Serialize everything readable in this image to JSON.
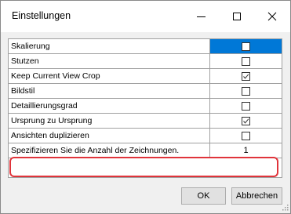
{
  "window": {
    "title": "Einstellungen"
  },
  "rows": [
    {
      "label": "Skalierung",
      "type": "checkbox",
      "checked": false,
      "selected": true
    },
    {
      "label": "Stutzen",
      "type": "checkbox",
      "checked": false,
      "selected": false
    },
    {
      "label": "Keep Current View Crop",
      "type": "checkbox",
      "checked": true,
      "selected": false
    },
    {
      "label": "Bildstil",
      "type": "checkbox",
      "checked": false,
      "selected": false
    },
    {
      "label": "Detaillierungsgrad",
      "type": "checkbox",
      "checked": false,
      "selected": false
    },
    {
      "label": "Ursprung zu Ursprung",
      "type": "checkbox",
      "checked": true,
      "selected": false
    },
    {
      "label": "Ansichten duplizieren",
      "type": "checkbox",
      "checked": false,
      "selected": false
    },
    {
      "label": "Spezifizieren Sie die Anzahl der Zeichnungen.",
      "type": "number",
      "value": "1",
      "selected": false
    }
  ],
  "buttons": {
    "ok": "OK",
    "cancel": "Abbrechen"
  },
  "colors": {
    "selection": "#0078d7",
    "highlight": "#e0343b"
  }
}
